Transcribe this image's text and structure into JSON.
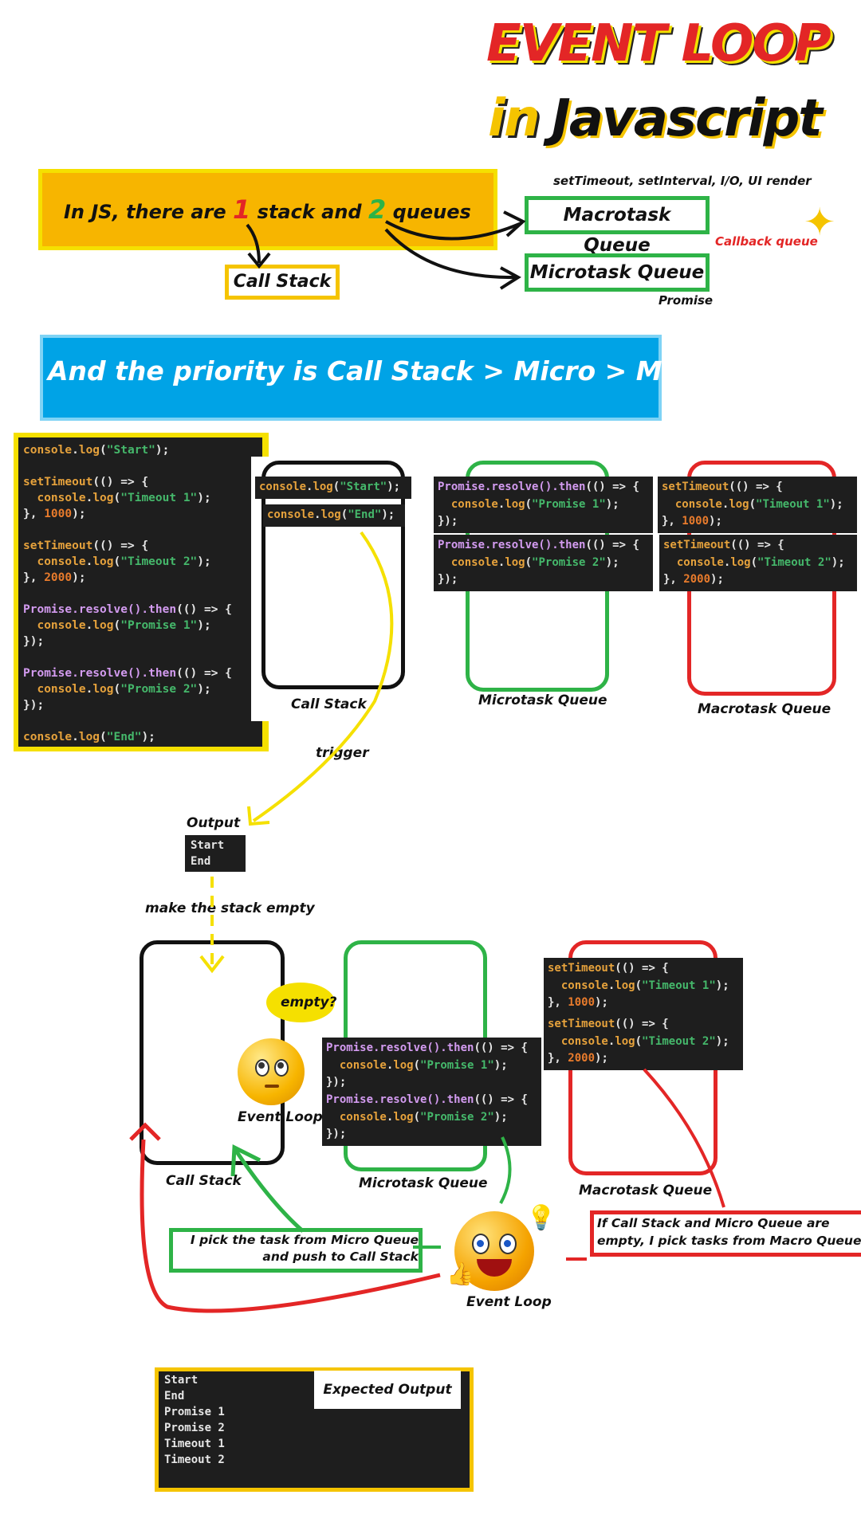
{
  "title": {
    "line1": "EVENT LOOP",
    "in": "in",
    "js": "Javascript"
  },
  "intro": {
    "prefix": "In JS, there are ",
    "n1": "1",
    "mid": " stack and ",
    "n2": "2",
    "suffix": " queues",
    "call_stack": "Call Stack",
    "macro_queue": "Macrotask Queue",
    "micro_queue": "Microtask Queue",
    "macro_sources": "setTimeout, setInterval, I/O, UI render",
    "callback_queue": "Callback queue",
    "micro_sources": "Promise"
  },
  "priority": "And the priority is Call Stack > Micro > Macro",
  "code_lines": [
    "console.log(\"Start\");",
    "",
    "setTimeout(() => {",
    "  console.log(\"Timeout 1\");",
    "}, 1000);",
    "",
    "setTimeout(() => {",
    "  console.log(\"Timeout 2\");",
    "}, 2000);",
    "",
    "Promise.resolve().then(() => {",
    "  console.log(\"Promise 1\");",
    "});",
    "",
    "Promise.resolve().then(() => {",
    "  console.log(\"Promise 2\");",
    "});",
    "",
    "console.log(\"End\");"
  ],
  "stack_snippets": [
    "console.log(\"Start\");",
    "console.log(\"End\");"
  ],
  "micro_snippets": [
    [
      "Promise.resolve().then(() => {",
      "  console.log(\"Promise 1\");",
      "});"
    ],
    [
      "Promise.resolve().then(() => {",
      "  console.log(\"Promise 2\");",
      "});"
    ]
  ],
  "macro_snippets": [
    [
      "setTimeout(() => {",
      "  console.log(\"Timeout 1\");",
      "}, 1000);"
    ],
    [
      "setTimeout(() => {",
      "  console.log(\"Timeout 2\");",
      "}, 2000);"
    ]
  ],
  "labels": {
    "call_stack": "Call Stack",
    "microtask_queue": "Microtask Queue",
    "macrotask_queue": "Macrotask Queue",
    "trigger": "trigger",
    "output": "Output",
    "make_empty": "make the stack empty",
    "empty_q": "empty?",
    "event_loop": "Event Loop",
    "pick_micro": "I pick the task from Micro Queue\nand push to Call Stack",
    "pick_macro": "If Call Stack and Micro Queue are\nempty, I pick tasks from Macro Queue",
    "expected_output": "Expected Output"
  },
  "output_lines": [
    "Start",
    "End"
  ],
  "expected_lines": [
    "Start",
    "End",
    "Promise 1",
    "Promise 2",
    "Timeout 1",
    "Timeout 2"
  ],
  "colors": {
    "yellow": "#f5c400",
    "green": "#2eb347",
    "red": "#e32626",
    "blue": "#00a3e6",
    "code_bg": "#1e1e1e"
  }
}
